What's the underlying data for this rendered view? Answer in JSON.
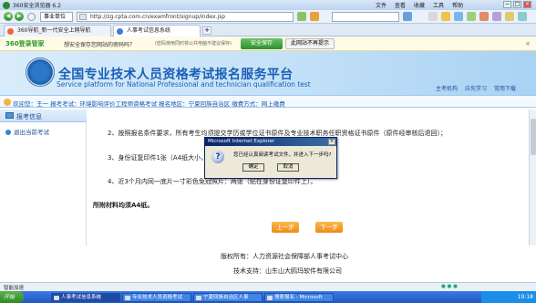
{
  "browser": {
    "title": "360安全浏览器 6.2",
    "menus": [
      "文件",
      "查看",
      "收藏",
      "工具",
      "帮助"
    ],
    "address": "http://zg.cpta.com.cn/examfront/signup/index.jsp",
    "dropdown_label": "事业单位",
    "tabs": [
      "360导航_新一代安全上网导航",
      "人事考试信息系统"
    ]
  },
  "bar360": {
    "brand": "360登录管家",
    "question": "想安全保存您网站的密码吗？",
    "subtext": "(密码使用同时将公共电脑不建议保存)",
    "save_button": "安全保存",
    "never_button": "此网站不再提示"
  },
  "banner": {
    "title_cn": "全国专业技术人员资格考试报名服务平台",
    "title_en": "Service platform for National Professional and technician qualification test",
    "links": [
      "主考机构",
      "应先学习",
      "常用下载"
    ]
  },
  "info": {
    "text": "欢迎您：王一  报考考试：环境影响评价工程师资格考试  报名地区：宁夏回族自治区  缴费方式：网上缴费"
  },
  "sidebar": {
    "heading": "报考信息",
    "item": "退出当前考试"
  },
  "main": {
    "line1": "2、按照报名条件要求，所有考生均须提交学历或学位证书原件及专业技术职务任职资格证书原件（原件经审核后退回）；",
    "line2": "3、身份证复印件1张（A4纸大小，复印正反两面）；",
    "line3": "4、近3个月内同一底片一寸彩色免冠照片：两张（贴在身份证复印件上）。",
    "note": "所附材料均须A4纸。",
    "prev_button": "上一步",
    "next_button": "下一步"
  },
  "modal": {
    "title": "Microsoft Internet Explorer",
    "message": "您已经认真阅读考试文件，并进入下一步吗?",
    "ok": "确定",
    "cancel": "取消",
    "close": "×"
  },
  "footer": {
    "owner": "版权所有：人力资源社会保障部人事考试中心",
    "support": "技术支持：山东山大鸥玛软件有限公司"
  },
  "statusbar": {
    "text": "智能加速"
  },
  "taskbar": {
    "start": "开始",
    "items": [
      "人事考试信息系统",
      "专业技术人员资格考试",
      "宁夏回族自治区人事",
      "搜索报名 - Microsoft"
    ],
    "clock": "19:18"
  }
}
